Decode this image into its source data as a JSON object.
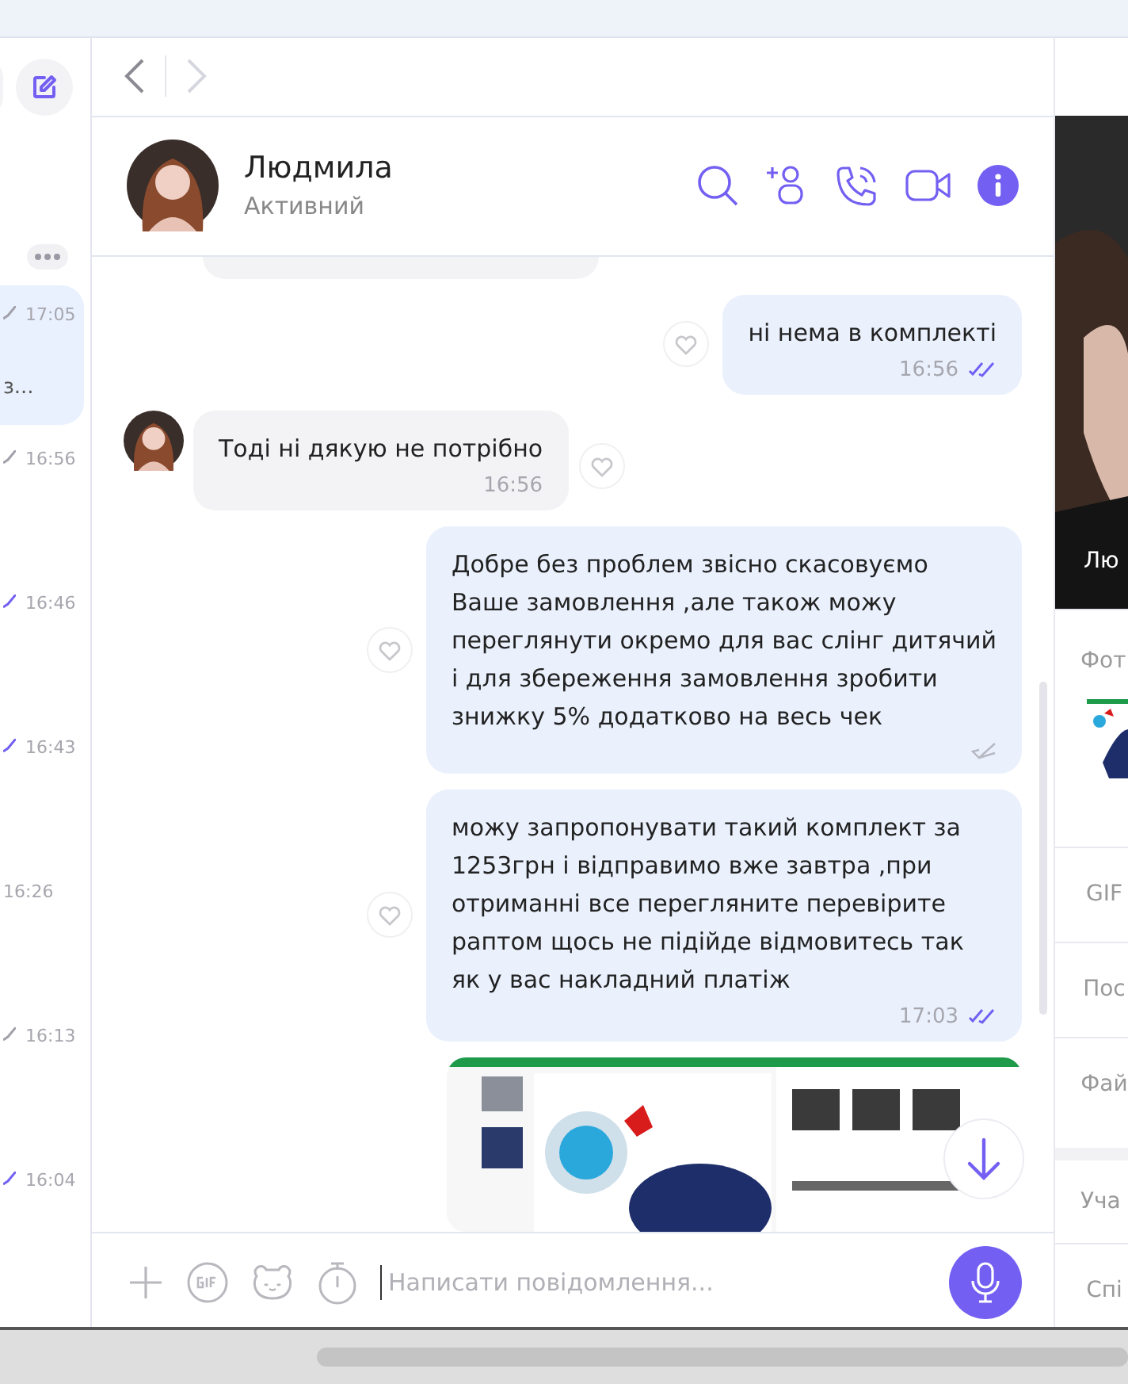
{
  "sidebar": {
    "chats": [
      {
        "kind": "sent",
        "time": "17:05",
        "preview": "з...",
        "selected": true
      },
      {
        "kind": "sent",
        "time": "16:56",
        "selected": false
      },
      {
        "kind": "read",
        "time": "16:46",
        "selected": false
      },
      {
        "kind": "read",
        "time": "16:43",
        "selected": false
      },
      {
        "kind": "incoming",
        "time": "16:26",
        "selected": false
      },
      {
        "kind": "sent",
        "time": "16:13",
        "selected": false
      },
      {
        "kind": "read",
        "time": "16:04",
        "selected": false
      }
    ]
  },
  "contact": {
    "name": "Людмила",
    "status": "Активний"
  },
  "messages": [
    {
      "kind": "cut"
    },
    {
      "kind": "outgoing",
      "text": "ні нема в комплекті",
      "time": "16:56",
      "read": true
    },
    {
      "kind": "incoming",
      "text": "Тоді ні дякую не потрібно",
      "time": "16:56"
    },
    {
      "kind": "outgoing",
      "text": "Добре без проблем звісно скасовуємо Ваше замовлення ,але також можу переглянути окремо для вас слінг дитячий і для збереження замовлення зробити знижку 5% додатково на весь чек",
      "read": false
    },
    {
      "kind": "outgoing",
      "text": "можу запропонувати такий комплект за 1253грн і відправимо вже завтра ,при отриманні все перегляните перевірите раптом щось не підійде відмовитесь так як у вас накладний платіж",
      "time": "17:03",
      "read": true
    },
    {
      "kind": "picture"
    }
  ],
  "composer": {
    "placeholder": "Написати повідомлення..."
  },
  "info_panel": {
    "photo_caption": "Лю",
    "sections": [
      {
        "kind": "gallery",
        "label": "Фот"
      },
      {
        "kind": "row",
        "label": "GIF"
      },
      {
        "kind": "row",
        "label": "Пос"
      },
      {
        "kind": "row",
        "label": "Фай"
      },
      {
        "kind": "spaced",
        "label": "Уча"
      },
      {
        "kind": "row",
        "label": "Спі"
      }
    ]
  }
}
